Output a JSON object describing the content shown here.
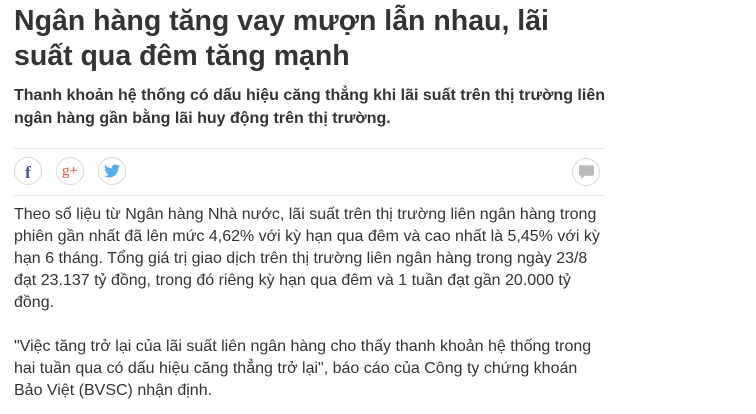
{
  "article": {
    "title": "Ngân hàng tăng vay mượn lẫn nhau, lãi suất qua đêm tăng mạnh",
    "sapo": "Thanh khoản hệ thống có dấu hiệu căng thẳng khi lãi suất trên thị trường liên ngân hàng gần bằng lãi huy động trên thị trường.",
    "paragraphs": [
      "Theo số liệu từ Ngân hàng Nhà nước, lãi suất trên thị trường liên ngân hàng trong phiên gần nhất đã lên mức 4,62% với kỳ hạn qua đêm và cao nhất là 5,45% với kỳ hạn 6 tháng. Tổng giá trị giao dịch trên thị trường liên ngân hàng trong ngày 23/8 đạt 23.137 tỷ đồng, trong đó riêng kỳ hạn qua đêm và 1 tuần đạt gần 20.000 tỷ đồng.",
      "\"Việc tăng trở lại của lãi suất liên ngân hàng cho thấy thanh khoản hệ thống trong hai tuần qua có dấu hiệu căng thẳng trở lại\", báo cáo của Công ty chứng khoán Bảo Việt (BVSC) nhận định."
    ]
  },
  "share": {
    "facebook_glyph": "f",
    "googleplus_glyph": "g+",
    "icons": [
      "facebook-icon",
      "google-plus-icon",
      "twitter-icon",
      "comment-icon"
    ]
  },
  "colors": {
    "text": "#333333",
    "facebook": "#3b5998",
    "googleplus": "#dd4b39",
    "twitter": "#55acee",
    "comment": "#bbbbbb",
    "divider": "#e4e4e4"
  }
}
